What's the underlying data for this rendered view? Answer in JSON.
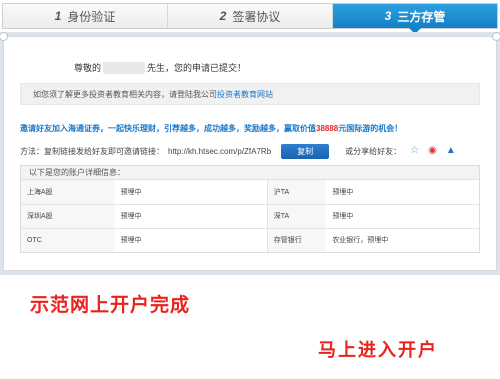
{
  "steps": [
    {
      "num": "1",
      "label": "身份验证"
    },
    {
      "num": "2",
      "label": "签署协议"
    },
    {
      "num": "3",
      "label": "三方存管"
    }
  ],
  "greeting": {
    "prefix": "尊敬的",
    "suffix": "先生，您的申请已提交！"
  },
  "notice": {
    "text": "如您须了解更多投资者教育相关内容，请登陆我公司",
    "link": "投资者教育网站"
  },
  "invite": {
    "text": "邀请好友加入海通证券，一起快乐理财，引荐越多，成功越多，奖励越多，赢取价值",
    "amount": "38888",
    "tail": "元国际游的机会！"
  },
  "share": {
    "label": "方法：复制链接发给好友即可邀请链接：",
    "url": "http://kh.htsec.com/p/ZfA7Rb",
    "copy_button": "复制",
    "share_to": "或分享给好友："
  },
  "details": {
    "header": "以下是您的账户详细信息：",
    "rows": [
      {
        "left_label": "上海A股",
        "left_value": "预埋中",
        "right_label": "沪TA",
        "right_value": "预埋中"
      },
      {
        "left_label": "深圳A股",
        "left_value": "预埋中",
        "right_label": "深TA",
        "right_value": "预埋中"
      },
      {
        "left_label": "OTC",
        "left_value": "预埋中",
        "right_label": "存管银行",
        "right_value": "农业银行，预埋中"
      }
    ]
  },
  "promo": {
    "line1": "示范网上开户完成",
    "line2": "马上进入开户"
  },
  "colors": {
    "accent": "#1581c6",
    "promo": "#e8231c",
    "link": "#1a73c9"
  }
}
